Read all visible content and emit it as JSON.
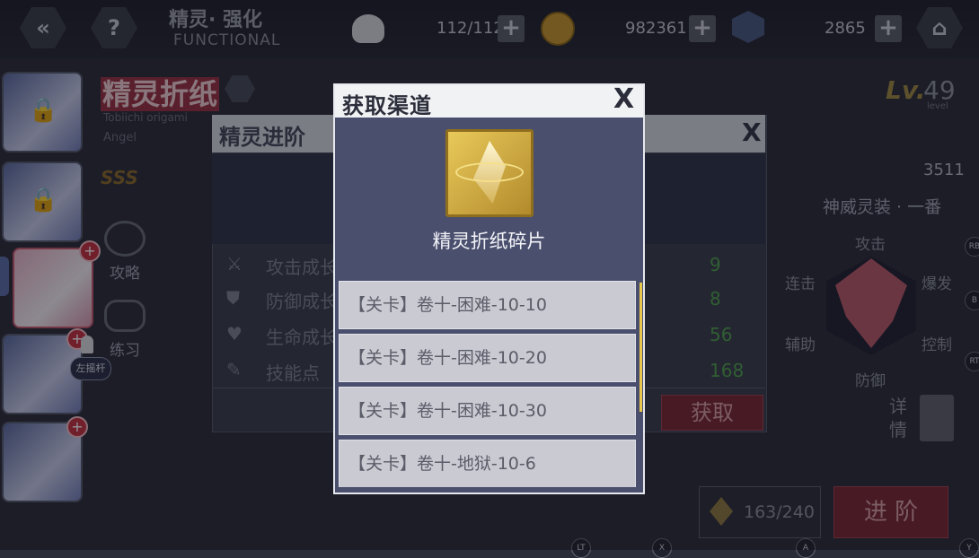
{
  "topbar": {
    "title": "精灵· 强化",
    "subtitle": "FUNCTIONAL",
    "stamina": "112/112",
    "gold": "982361",
    "gems": "2865",
    "back_icon": "double-chevron-left-icon",
    "help_icon": "question-icon",
    "home_icon": "home-icon"
  },
  "character": {
    "name": "精灵折纸",
    "name_en": "Tobiichi origami",
    "class": "Angel",
    "level_prefix": "Lv.",
    "level": "49",
    "level_label": "level",
    "power": "3511",
    "outfit": "神威灵装 · 一番",
    "grade_badge": "SSS"
  },
  "sidebar": {
    "strategy": "攻略",
    "practice": "练习",
    "joystick_hint": "左摇杆"
  },
  "bg_panel": {
    "title": "精灵进阶",
    "stats": [
      {
        "label": "攻击成长",
        "value": "9"
      },
      {
        "label": "防御成长",
        "value": "8"
      },
      {
        "label": "生命成长",
        "value": "56"
      },
      {
        "label": "技能点",
        "value": "168"
      }
    ],
    "obtain_button": "获取"
  },
  "radar": {
    "attack": "攻击",
    "combo": "连击",
    "burst": "爆发",
    "support": "辅助",
    "control": "控制",
    "defense": "防御"
  },
  "details_label": "详情",
  "bottom": {
    "fragments": "163/240",
    "advance_button": "进 阶"
  },
  "modal": {
    "title": "获取渠道",
    "close": "X",
    "item_name": "精灵折纸碎片",
    "sources": [
      "【关卡】卷十-困难-10-10",
      "【关卡】卷十-困难-10-20",
      "【关卡】卷十-困难-10-30",
      "【关卡】卷十-地狱-10-6"
    ]
  },
  "controller_hints": {
    "rb": "RB",
    "b": "B",
    "rt": "RT",
    "lt": "LT",
    "x": "X",
    "a": "A",
    "y": "Y"
  }
}
